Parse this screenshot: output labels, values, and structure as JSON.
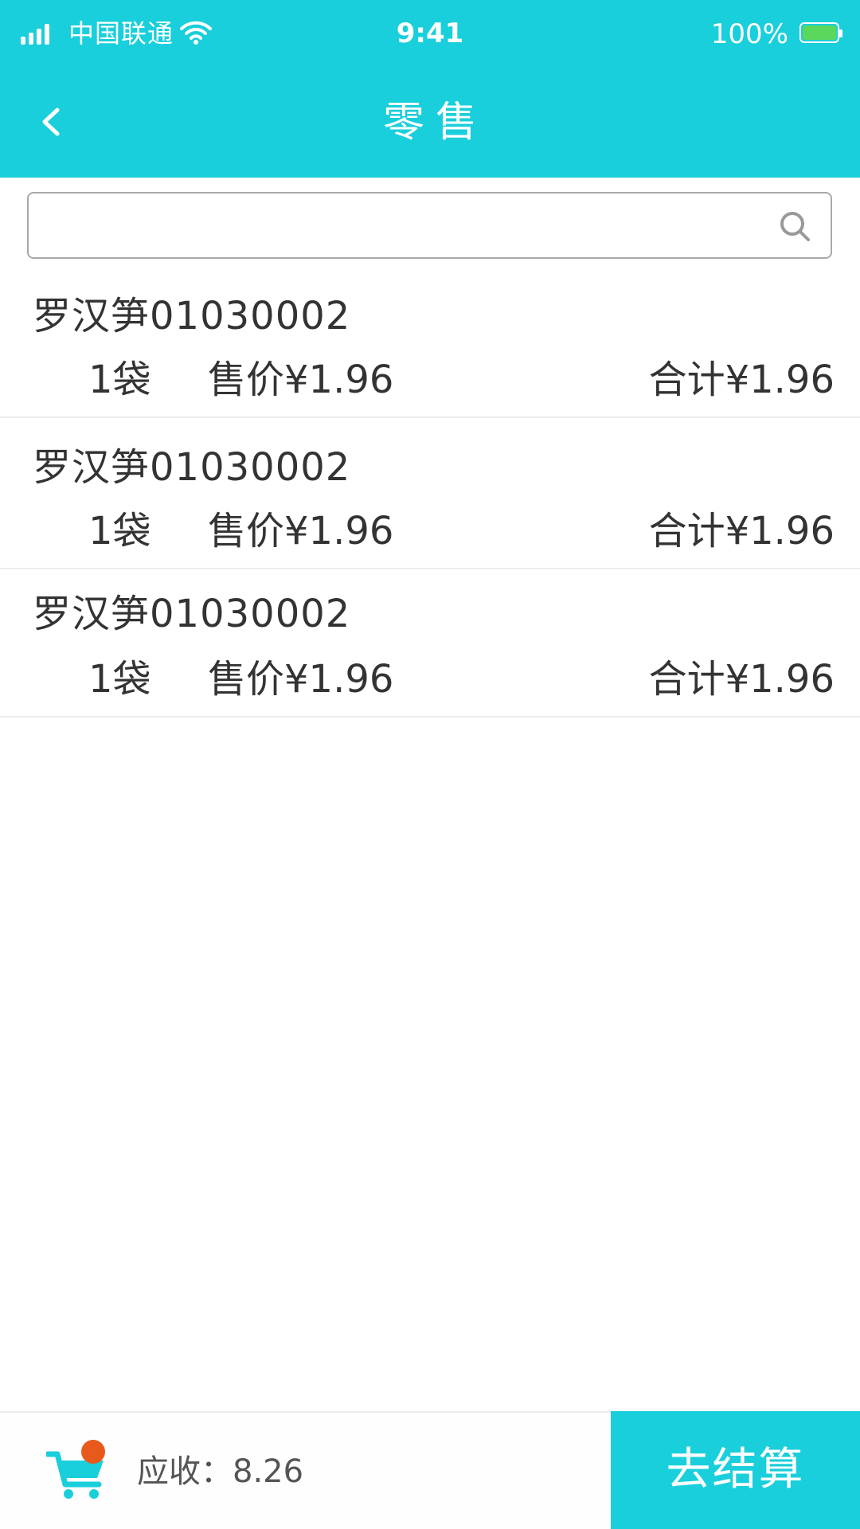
{
  "status_bar": {
    "carrier": "中国联通",
    "time": "9:41",
    "battery_percent": "100%",
    "signal_icon": "signal-bars-icon",
    "wifi_icon": "wifi-icon",
    "battery_icon": "battery-icon",
    "battery_color": "#5bd85b"
  },
  "nav": {
    "title": "零售",
    "back_icon": "chevron-left-icon"
  },
  "search": {
    "value": "",
    "placeholder": "",
    "icon": "search-icon"
  },
  "items": [
    {
      "name": "罗汉笋01030002",
      "qty": "1袋",
      "price": "售价¥1.96",
      "total": "合计¥1.96"
    },
    {
      "name": "罗汉笋01030002",
      "qty": "1袋",
      "price": "售价¥1.96",
      "total": "合计¥1.96"
    },
    {
      "name": "罗汉笋01030002",
      "qty": "1袋",
      "price": "售价¥1.96",
      "total": "合计¥1.96"
    }
  ],
  "footer": {
    "cart_icon": "shopping-cart-icon",
    "receivable": "应收：8.26",
    "checkout_label": "去结算"
  },
  "colors": {
    "accent": "#19cfdb",
    "badge": "#e85a1c",
    "text": "#333333",
    "divider": "#ececec"
  }
}
